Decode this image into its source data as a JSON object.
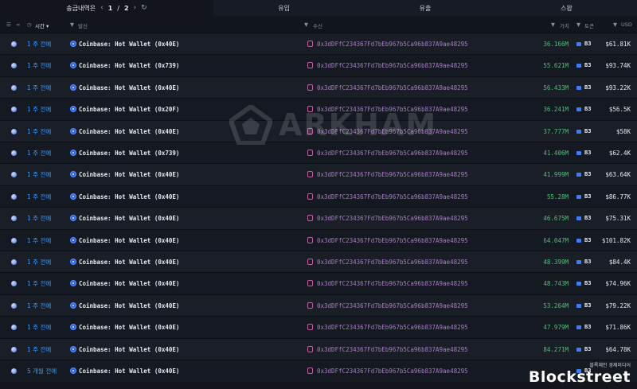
{
  "topbar": {
    "title": "송금내역은",
    "prev_icon": "chevron-left-icon",
    "page": "1",
    "page_sep": "/",
    "page_total": "2",
    "next_icon": "chevron-right-icon",
    "refresh_icon": "refresh-icon",
    "tabs": [
      "유입",
      "유출",
      "스왑"
    ]
  },
  "header": {
    "time": "시간",
    "from": "발신",
    "to": "수신",
    "value": "가치",
    "token": "토큰",
    "usd": "USD"
  },
  "watermark": "ARKHAM",
  "brand": {
    "sub": "블록체인 경제미디어",
    "main": "Blockstreet"
  },
  "colors": {
    "accent": "#3b9cff",
    "positive": "#49c372",
    "address": "#a67fbf"
  },
  "rows": [
    {
      "time": "1 주 전에",
      "from": "Coinbase: Hot Wallet (0x40E)",
      "to": "0x3dDFfC234367Fd7bEb967b5Ca96b837A9ae48295",
      "value": "36.166M",
      "token": "B3",
      "usd": "$61.81K"
    },
    {
      "time": "1 주 전에",
      "from": "Coinbase: Hot Wallet (0x739)",
      "to": "0x3dDFfC234367Fd7bEb967b5Ca96b837A9ae48295",
      "value": "55.621M",
      "token": "B3",
      "usd": "$93.74K"
    },
    {
      "time": "1 주 전에",
      "from": "Coinbase: Hot Wallet (0x40E)",
      "to": "0x3dDFfC234367Fd7bEb967b5Ca96b837A9ae48295",
      "value": "56.433M",
      "token": "B3",
      "usd": "$93.22K"
    },
    {
      "time": "1 주 전에",
      "from": "Coinbase: Hot Wallet (0x20F)",
      "to": "0x3dDFfC234367Fd7bEb967b5Ca96b837A9ae48295",
      "value": "36.241M",
      "token": "B3",
      "usd": "$56.5K"
    },
    {
      "time": "1 주 전에",
      "from": "Coinbase: Hot Wallet (0x40E)",
      "to": "0x3dDFfC234367Fd7bEb967b5Ca96b837A9ae48295",
      "value": "37.777M",
      "token": "B3",
      "usd": "$58K"
    },
    {
      "time": "1 주 전에",
      "from": "Coinbase: Hot Wallet (0x739)",
      "to": "0x3dDFfC234367Fd7bEb967b5Ca96b837A9ae48295",
      "value": "41.406M",
      "token": "B3",
      "usd": "$62.4K"
    },
    {
      "time": "1 주 전에",
      "from": "Coinbase: Hot Wallet (0x40E)",
      "to": "0x3dDFfC234367Fd7bEb967b5Ca96b837A9ae48295",
      "value": "41.999M",
      "token": "B3",
      "usd": "$63.64K"
    },
    {
      "time": "1 주 전에",
      "from": "Coinbase: Hot Wallet (0x40E)",
      "to": "0x3dDFfC234367Fd7bEb967b5Ca96b837A9ae48295",
      "value": "55.28M",
      "token": "B3",
      "usd": "$86.77K"
    },
    {
      "time": "1 주 전에",
      "from": "Coinbase: Hot Wallet (0x40E)",
      "to": "0x3dDFfC234367Fd7bEb967b5Ca96b837A9ae48295",
      "value": "46.675M",
      "token": "B3",
      "usd": "$75.31K"
    },
    {
      "time": "1 주 전에",
      "from": "Coinbase: Hot Wallet (0x40E)",
      "to": "0x3dDFfC234367Fd7bEb967b5Ca96b837A9ae48295",
      "value": "64.047M",
      "token": "B3",
      "usd": "$101.82K"
    },
    {
      "time": "1 주 전에",
      "from": "Coinbase: Hot Wallet (0x40E)",
      "to": "0x3dDFfC234367Fd7bEb967b5Ca96b837A9ae48295",
      "value": "48.399M",
      "token": "B3",
      "usd": "$84.4K"
    },
    {
      "time": "1 주 전에",
      "from": "Coinbase: Hot Wallet (0x40E)",
      "to": "0x3dDFfC234367Fd7bEb967b5Ca96b837A9ae48295",
      "value": "48.743M",
      "token": "B3",
      "usd": "$74.96K"
    },
    {
      "time": "1 주 전에",
      "from": "Coinbase: Hot Wallet (0x40E)",
      "to": "0x3dDFfC234367Fd7bEb967b5Ca96b837A9ae48295",
      "value": "53.264M",
      "token": "B3",
      "usd": "$79.22K"
    },
    {
      "time": "1 주 전에",
      "from": "Coinbase: Hot Wallet (0x40E)",
      "to": "0x3dDFfC234367Fd7bEb967b5Ca96b837A9ae48295",
      "value": "47.979M",
      "token": "B3",
      "usd": "$71.86K"
    },
    {
      "time": "1 주 전에",
      "from": "Coinbase: Hot Wallet (0x40E)",
      "to": "0x3dDFfC234367Fd7bEb967b5Ca96b837A9ae48295",
      "value": "84.271M",
      "token": "B3",
      "usd": "$64.78K"
    },
    {
      "time": "5 개월 전에",
      "from": "Coinbase: Hot Wallet (0x40E)",
      "to": "0x3dDFfC234367Fd7bEb967b5Ca96b837A9ae48295",
      "value": "",
      "token": "B3",
      "usd": ""
    }
  ]
}
